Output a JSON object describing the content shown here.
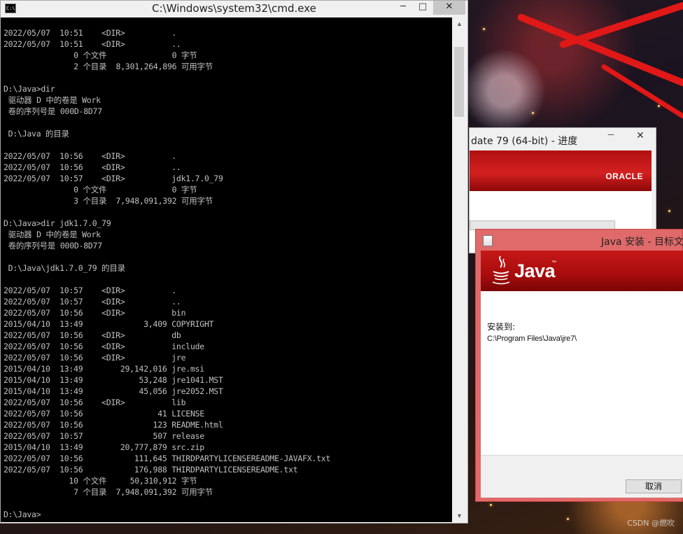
{
  "cmd": {
    "title": "C:\\Windows\\system32\\cmd.exe",
    "icon_text": "C:\\",
    "buttons": {
      "minimize": "─",
      "maximize": "□",
      "close": "✕"
    },
    "lines": [
      "2022/05/07  10:51    <DIR>          .",
      "2022/05/07  10:51    <DIR>          ..",
      "               0 个文件              0 字节",
      "               2 个目录  8,301,264,896 可用字节",
      "",
      "D:\\Java>dir",
      " 驱动器 D 中的卷是 Work",
      " 卷的序列号是 000D-8D77",
      "",
      " D:\\Java 的目录",
      "",
      "2022/05/07  10:56    <DIR>          .",
      "2022/05/07  10:56    <DIR>          ..",
      "2022/05/07  10:57    <DIR>          jdk1.7.0_79",
      "               0 个文件              0 字节",
      "               3 个目录  7,948,091,392 可用字节",
      "",
      "D:\\Java>dir jdk1.7.0_79",
      " 驱动器 D 中的卷是 Work",
      " 卷的序列号是 000D-8D77",
      "",
      " D:\\Java\\jdk1.7.0_79 的目录",
      "",
      "2022/05/07  10:57    <DIR>          .",
      "2022/05/07  10:57    <DIR>          ..",
      "2022/05/07  10:56    <DIR>          bin",
      "2015/04/10  13:49             3,409 COPYRIGHT",
      "2022/05/07  10:56    <DIR>          db",
      "2022/05/07  10:56    <DIR>          include",
      "2022/05/07  10:56    <DIR>          jre",
      "2015/04/10  13:49        29,142,016 jre.msi",
      "2015/04/10  13:49            53,248 jre1041.MST",
      "2015/04/10  13:49            45,056 jre2052.MST",
      "2022/05/07  10:56    <DIR>          lib",
      "2022/05/07  10:56                41 LICENSE",
      "2022/05/07  10:56               123 README.html",
      "2022/05/07  10:57               507 release",
      "2015/04/10  13:49        20,777,879 src.zip",
      "2022/05/07  10:56           111,645 THIRDPARTYLICENSEREADME-JAVAFX.txt",
      "2022/05/07  10:56           176,988 THIRDPARTYLICENSEREADME.txt",
      "              10 个文件     50,310,912 字节",
      "               7 个目录  7,948,091,392 可用字节",
      "",
      "D:\\Java>"
    ]
  },
  "jdk_installer": {
    "title": "date 79 (64-bit) - 进度",
    "minimize": "─",
    "close": "✕",
    "brand": "ORACLE"
  },
  "java_setup": {
    "title": "Java 安装 - 目标文",
    "brand": "Java",
    "trademark": "™",
    "install_to_label": "安装到:",
    "install_path": "C:\\Program Files\\Java\\jre7\\",
    "cancel_label": "取消"
  },
  "watermark": "CSDN @燃吹",
  "colors": {
    "console_bg": "#000000",
    "console_fg": "#c0c0c0",
    "java_red": "#c51818",
    "java_window_frame": "#e06a6a"
  }
}
